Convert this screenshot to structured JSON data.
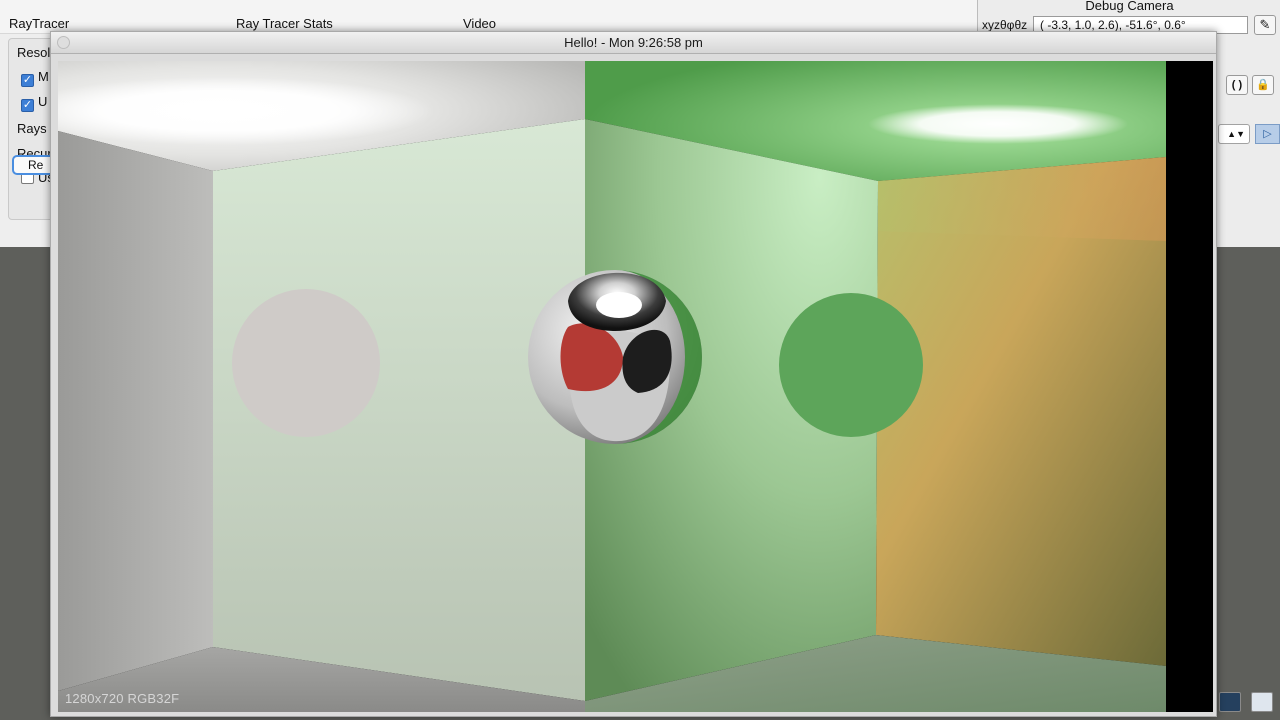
{
  "background_app": {
    "tabs": [
      "RayTracer",
      "Ray Tracer Stats",
      "Video"
    ],
    "panel": {
      "resolution_label": "Resol",
      "checkbox_1_label": "M",
      "checkbox_2_label": "U",
      "rays_label": "Rays",
      "recursion_label": "Recur",
      "checkbox_3_label": "Us",
      "render_button_label": "Re"
    }
  },
  "debug_camera": {
    "title": "Debug Camera",
    "xyz_label": "xyzθφθz",
    "value": "( -3.3,   1.0,   2.6), -51.6°,   0.6°",
    "edit_icon": "pencil-icon",
    "buttons": [
      "( )",
      "lock"
    ],
    "stepper_icon": "up-down-icon",
    "play_icon": "play-icon"
  },
  "render_window": {
    "title": "Hello! - Mon 9:26:58 pm",
    "resolution_label": "1280x720 RGB32F"
  },
  "colors": {
    "accent": "#3d7fd6",
    "wall_green": "#5fa35f",
    "wall_orange": "#d79a5b"
  }
}
